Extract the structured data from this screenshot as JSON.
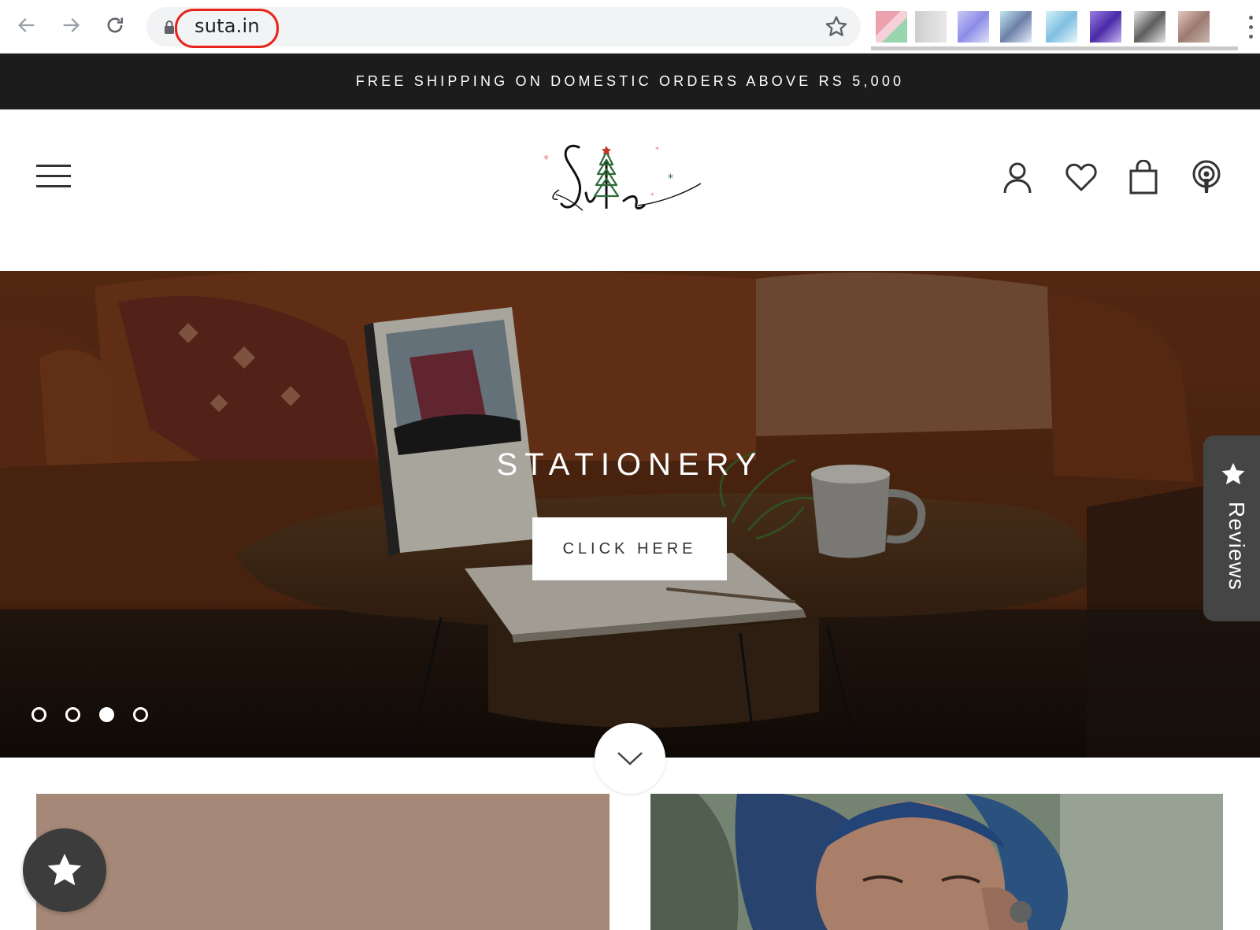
{
  "browser": {
    "url": "suta.in",
    "back_icon": "arrow-left-icon",
    "forward_icon": "arrow-right-icon",
    "reload_icon": "reload-icon",
    "bookmark_icon": "star-outline-icon",
    "highlight_color": "#e8241b"
  },
  "announcement": {
    "text": "FREE SHIPPING ON DOMESTIC ORDERS ABOVE RS 5,000"
  },
  "header": {
    "logo_text": "Suta",
    "menu_icon": "hamburger-icon",
    "icons": [
      "account-icon",
      "heart-icon",
      "bag-icon",
      "podcast-icon"
    ]
  },
  "hero": {
    "title": "STATIONERY",
    "cta_label": "CLICK HERE",
    "slides_total": 4,
    "active_slide": 3
  },
  "reviews_tab": {
    "label": "Reviews"
  },
  "colors": {
    "announcement_bg": "#1c1c1c",
    "reviews_bg": "#454545",
    "card_left_bg": "#a58877"
  }
}
